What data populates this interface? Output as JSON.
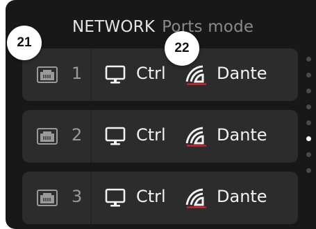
{
  "header": {
    "title": "NETWORK",
    "mode": "Ports mode"
  },
  "ports": [
    {
      "number": "1",
      "ctrl_label": "Ctrl",
      "dante_label": "Dante"
    },
    {
      "number": "2",
      "ctrl_label": "Ctrl",
      "dante_label": "Dante"
    },
    {
      "number": "3",
      "ctrl_label": "Ctrl",
      "dante_label": "Dante"
    }
  ],
  "icons": {
    "port": "ethernet-port-icon",
    "ctrl": "monitor-icon",
    "dante": "dante-logo-icon"
  },
  "scroll_indicator": {
    "dot_count": 8,
    "active_index": 5
  },
  "callouts": [
    "21",
    "22"
  ],
  "colors": {
    "background": "#181818",
    "row": "#2c2c2c",
    "dante_accent": "#e0202e",
    "active_dot": "#ffffff"
  }
}
